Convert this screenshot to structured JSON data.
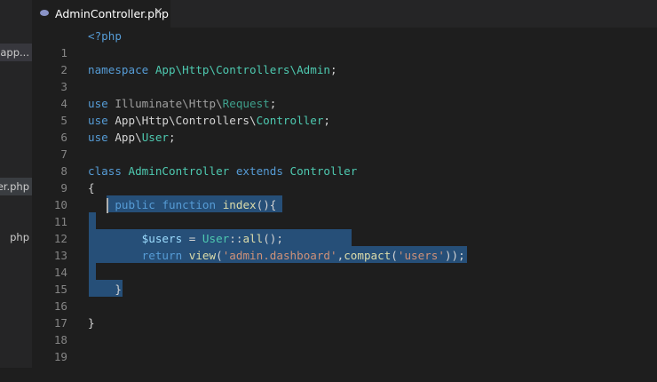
{
  "sidebar": {
    "items": [
      {
        "label": "app..."
      },
      {
        "label": "ller.php"
      },
      {
        "label": "php"
      }
    ]
  },
  "tab": {
    "title": "AdminController.php",
    "close": "×"
  },
  "editor": {
    "line_numbers": [
      "1",
      "2",
      "3",
      "4",
      "5",
      "6",
      "7",
      "8",
      "9",
      "10",
      "11",
      "12",
      "13",
      "14",
      "15",
      "16",
      "17",
      "18",
      "19"
    ],
    "tokens": {
      "l1": "<?php",
      "l3_kw": "namespace",
      "l3_ns": "App\\Http\\Controllers\\Admin",
      "l3_semi": ";",
      "l5_kw": "use",
      "l5_a": "Illuminate\\Http\\",
      "l5_b": "Request",
      "l5_semi": ";",
      "l6_kw": "use",
      "l6_a": "App\\Http\\Controllers\\",
      "l6_b": "Controller",
      "l6_semi": ";",
      "l7_kw": "use",
      "l7_a": "App\\",
      "l7_b": "User",
      "l7_semi": ";",
      "l9_kw": "class",
      "l9_name": "AdminController",
      "l9_ext": "extends",
      "l9_parent": "Controller",
      "l10": "{",
      "l11_kw1": "public",
      "l11_kw2": "function",
      "l11_fn": "index",
      "l11_rest": "(){",
      "l13_var": "$users",
      "l13_eq": " = ",
      "l13_cls": "User",
      "l13_op": "::",
      "l13_fn": "all",
      "l13_rest": "();",
      "l14_kw": "return",
      "l14_fn": "view",
      "l14_p1": "(",
      "l14_s1": "'admin.dashboard'",
      "l14_comma": ",",
      "l14_fn2": "compact",
      "l14_p2": "(",
      "l14_s2": "'users'",
      "l14_end": "));",
      "l16": "}",
      "l18": "}"
    }
  }
}
